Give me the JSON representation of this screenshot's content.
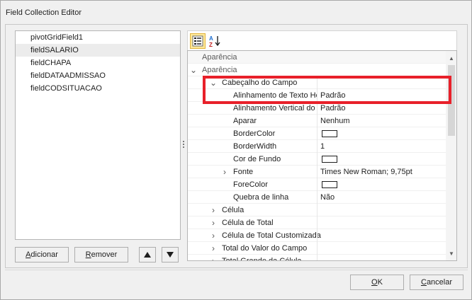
{
  "window": {
    "title": "Field Collection Editor"
  },
  "fields": {
    "items": [
      {
        "label": "pivotGridField1",
        "selected": false
      },
      {
        "label": "fieldSALARIO",
        "selected": true
      },
      {
        "label": "fieldCHAPA",
        "selected": false
      },
      {
        "label": "fieldDATAADMISSAO",
        "selected": false
      },
      {
        "label": "fieldCODSITUACAO",
        "selected": false
      }
    ]
  },
  "list_buttons": {
    "add_first": "A",
    "add_rest": "dicionar",
    "remove_first": "R",
    "remove_rest": "emover",
    "up_icon": "arrow-up-icon",
    "down_icon": "arrow-down-icon"
  },
  "toolbar": {
    "categorized_icon": "categorized-icon",
    "alphabetical_icon": "sort-az-icon"
  },
  "properties": {
    "rows": [
      {
        "name": "Aparência",
        "value": "",
        "level": 0,
        "kind": "category-header"
      },
      {
        "name": "Aparência",
        "value": "",
        "level": 1,
        "kind": "category",
        "expanded": true
      },
      {
        "name": "Cabeçalho do Campo",
        "value": "",
        "level": 2,
        "kind": "group",
        "expanded": true
      },
      {
        "name": "Alinhamento de Texto Horizontal",
        "value": "Padrão",
        "level": 3,
        "kind": "property"
      },
      {
        "name": "Alinhamento Vertical do Texto",
        "value": "Padrão",
        "level": 3,
        "kind": "property"
      },
      {
        "name": "Aparar",
        "value": "Nenhum",
        "level": 3,
        "kind": "property"
      },
      {
        "name": "BorderColor",
        "value": "",
        "level": 3,
        "kind": "color"
      },
      {
        "name": "BorderWidth",
        "value": "1",
        "level": 3,
        "kind": "property"
      },
      {
        "name": "Cor de Fundo",
        "value": "",
        "level": 3,
        "kind": "color"
      },
      {
        "name": "Fonte",
        "value": "Times New Roman; 9,75pt",
        "level": 3,
        "kind": "expandable",
        "expanded": false
      },
      {
        "name": "ForeColor",
        "value": "",
        "level": 3,
        "kind": "color"
      },
      {
        "name": "Quebra de linha",
        "value": "Não",
        "level": 3,
        "kind": "property"
      },
      {
        "name": "Célula",
        "value": "",
        "level": 2,
        "kind": "group",
        "expanded": false
      },
      {
        "name": "Célula de Total",
        "value": "",
        "level": 2,
        "kind": "group",
        "expanded": false
      },
      {
        "name": "Célula de Total Customizada",
        "value": "",
        "level": 2,
        "kind": "group",
        "expanded": false
      },
      {
        "name": "Total do Valor do Campo",
        "value": "",
        "level": 2,
        "kind": "group",
        "expanded": false
      },
      {
        "name": "Total Grande da Célula",
        "value": "",
        "level": 2,
        "kind": "group",
        "expanded": false
      }
    ]
  },
  "dialog_buttons": {
    "ok_first": "O",
    "ok_rest": "K",
    "cancel_first": "C",
    "cancel_rest": "ancelar"
  },
  "colors": {
    "highlight": "#e8202a",
    "selected_row": "#ececec",
    "toolbar_active": "#fde89a"
  }
}
